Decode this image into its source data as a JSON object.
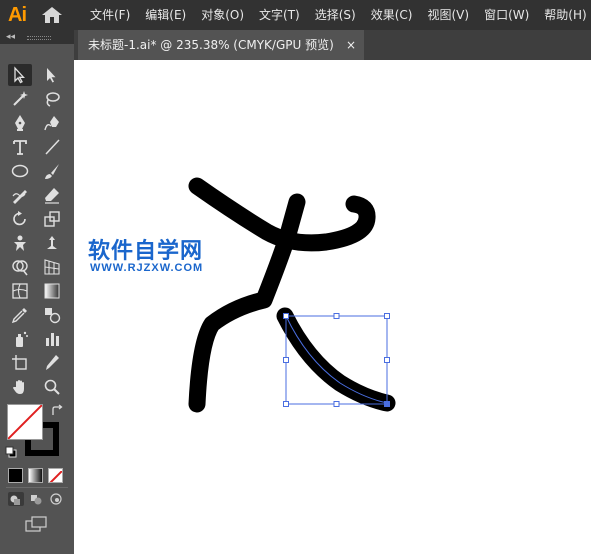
{
  "app": {
    "logo": "Ai",
    "home_icon": "home-icon"
  },
  "menu": {
    "items": [
      {
        "label": "文件(F)"
      },
      {
        "label": "编辑(E)"
      },
      {
        "label": "对象(O)"
      },
      {
        "label": "文字(T)"
      },
      {
        "label": "选择(S)"
      },
      {
        "label": "效果(C)"
      },
      {
        "label": "视图(V)"
      },
      {
        "label": "窗口(W)"
      },
      {
        "label": "帮助(H)"
      }
    ]
  },
  "toolbar": {
    "collapse_label": "◂◂"
  },
  "tools": [
    "selection-tool-icon",
    "direct-selection-tool-icon",
    "magic-wand-tool-icon",
    "lasso-tool-icon",
    "pen-tool-icon",
    "curvature-tool-icon",
    "type-tool-icon",
    "line-segment-tool-icon",
    "ellipse-tool-icon",
    "paintbrush-tool-icon",
    "shaper-tool-icon",
    "eraser-tool-icon",
    "rotate-tool-icon",
    "scale-tool-icon",
    "puppet-warp-tool-icon",
    "free-transform-tool-icon",
    "shape-builder-tool-icon",
    "perspective-grid-tool-icon",
    "mesh-tool-icon",
    "gradient-tool-icon",
    "eyedropper-tool-icon",
    "blend-tool-icon",
    "symbol-sprayer-tool-icon",
    "column-graph-tool-icon",
    "artboard-tool-icon",
    "slice-tool-icon",
    "hand-tool-icon",
    "zoom-tool-icon"
  ],
  "document": {
    "tab_label": "未标题-1.ai* @ 235.38% (CMYK/GPU 预览)",
    "close_label": "×"
  },
  "watermark": {
    "cn": "软件自学网",
    "en": "WWW.RJZXW.COM"
  },
  "colors": {
    "menubar": "#323232",
    "panel": "#535353",
    "canvas": "#ffffff",
    "selection": "#4a6ee0",
    "watermark": "#1a66cc",
    "logo": "#ff9a00"
  }
}
